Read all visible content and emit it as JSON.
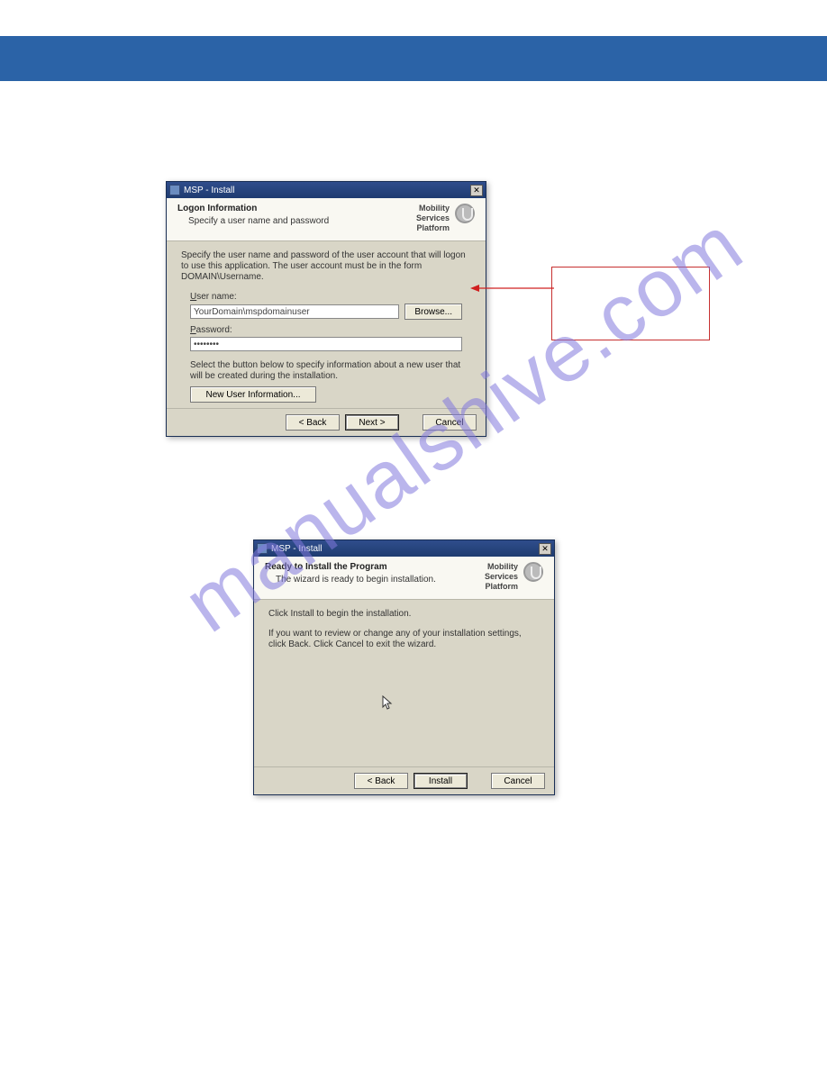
{
  "page": {
    "watermark": "manualshive.com"
  },
  "dialog1": {
    "title": "MSP - Install",
    "close": "✕",
    "header": {
      "heading": "Logon Information",
      "subheading": "Specify a user name and password",
      "brand1": "Mobility",
      "brand2": "Services",
      "brand3": "Platform"
    },
    "body": {
      "instruction": "Specify the user name and password of the user account that will logon to use this application. The user account must be in the form DOMAIN\\Username.",
      "username_label": "User name:",
      "username_value": "YourDomain\\mspdomainuser",
      "browse_label": "Browse...",
      "password_label": "Password:",
      "password_value": "••••••••",
      "newuser_note": "Select the button below to specify information about a new user that will be created during the installation.",
      "newuser_button": "New User Information..."
    },
    "footer": {
      "back": "< Back",
      "next": "Next >",
      "cancel": "Cancel"
    }
  },
  "dialog2": {
    "title": "MSP - Install",
    "close": "✕",
    "header": {
      "heading": "Ready to Install the Program",
      "subheading": "The wizard is ready to begin installation.",
      "brand1": "Mobility",
      "brand2": "Services",
      "brand3": "Platform"
    },
    "body": {
      "line1": "Click Install to begin the installation.",
      "line2": "If you want to review or change any of your installation settings, click Back. Click Cancel to exit the wizard."
    },
    "footer": {
      "back": "< Back",
      "install": "Install",
      "cancel": "Cancel"
    }
  }
}
